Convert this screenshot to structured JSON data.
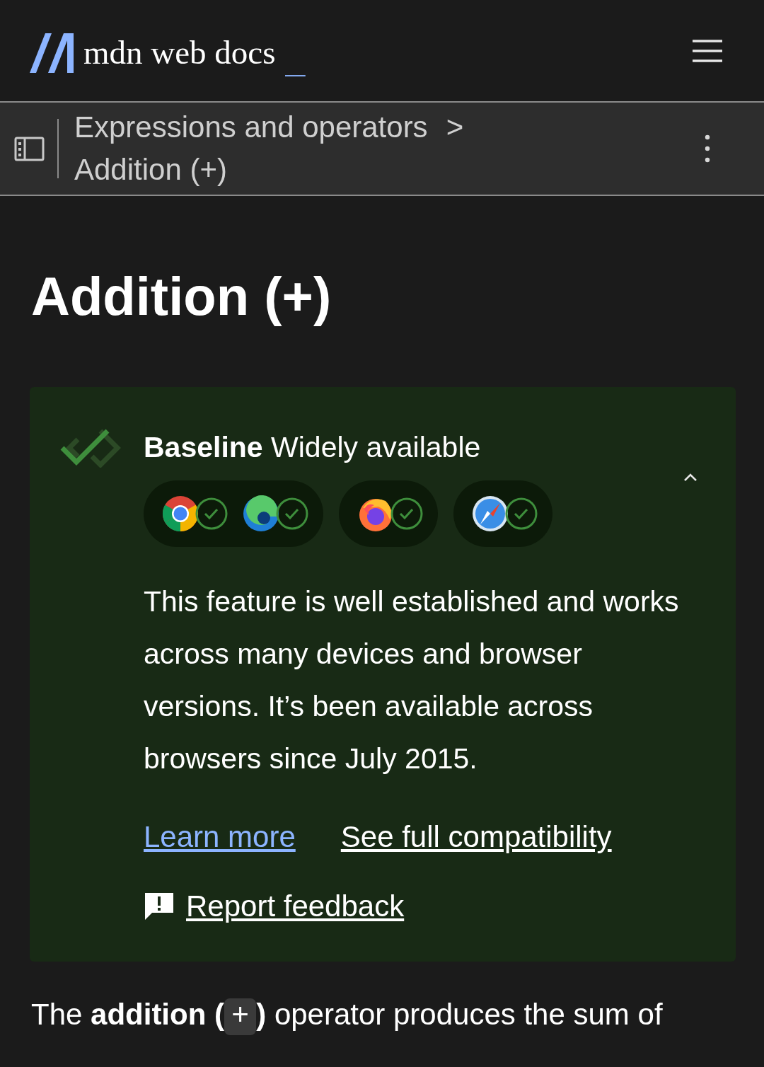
{
  "header": {
    "logo_text": "mdn web docs",
    "cursor": "_"
  },
  "breadcrumb": {
    "parent": "Expressions and operators",
    "separator": ">",
    "current": "Addition (+)"
  },
  "title": "Addition (+)",
  "baseline": {
    "label": "Baseline",
    "status": "Widely available",
    "expanded": true,
    "browser_groups": [
      [
        {
          "kind": "chrome",
          "supported": true
        },
        {
          "kind": "edge",
          "supported": true
        }
      ],
      [
        {
          "kind": "firefox",
          "supported": true
        }
      ],
      [
        {
          "kind": "safari",
          "supported": true
        }
      ]
    ],
    "description": "This feature is well established and works across many devices and browser versions. It’s been available across browsers since July 2015.",
    "links": [
      "Learn more",
      "See full compatibility"
    ],
    "feedback": "Report feedback"
  },
  "intro": {
    "before": "The ",
    "term": "addition (",
    "code": "+",
    "after_term": ")",
    "rest": " operator produces the sum of"
  }
}
